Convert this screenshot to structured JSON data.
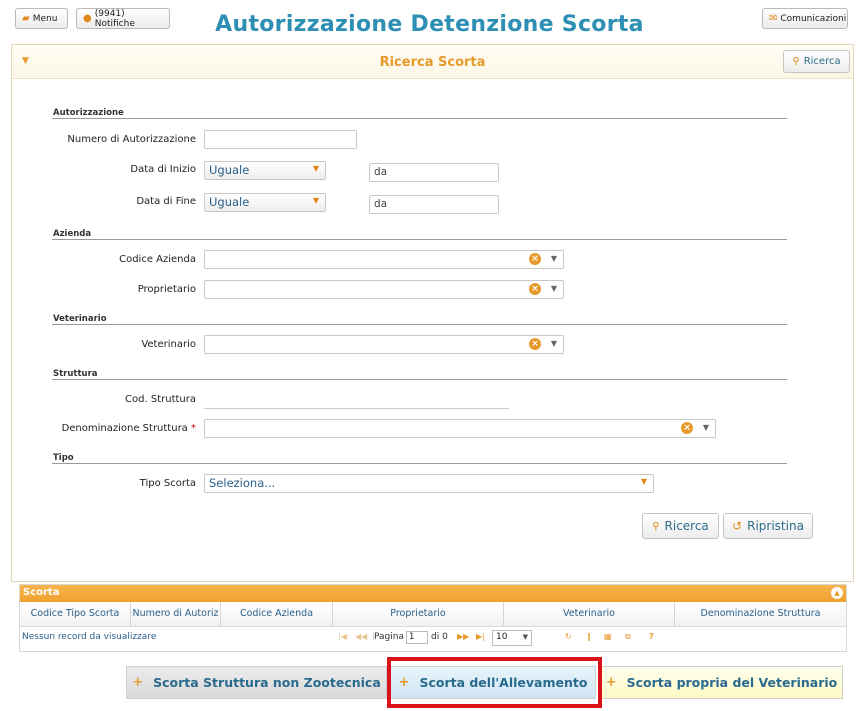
{
  "top": {
    "menu_label": "Menu",
    "notifications_label": "(9941) Notifiche",
    "communications_label": "Comunicazioni"
  },
  "page_title": "Autorizzazione Detenzione Scorta",
  "search": {
    "title": "Ricerca Scorta",
    "top_button": "Ricerca",
    "sections": {
      "autorizzazione": "Autorizzazione",
      "azienda": "Azienda",
      "veterinario": "Veterinario",
      "struttura": "Struttura",
      "tipo": "Tipo"
    },
    "fields": {
      "numero_autorizzazione": {
        "label": "Numero di Autorizzazione",
        "value": ""
      },
      "data_inizio": {
        "label": "Data di Inizio",
        "operator": "Uguale",
        "placeholder": "da"
      },
      "data_fine": {
        "label": "Data di Fine",
        "operator": "Uguale",
        "placeholder": "da"
      },
      "codice_azienda": {
        "label": "Codice Azienda",
        "value": ""
      },
      "proprietario": {
        "label": "Proprietario",
        "value": ""
      },
      "veterinario": {
        "label": "Veterinario",
        "value": ""
      },
      "cod_struttura": {
        "label": "Cod. Struttura",
        "value": ""
      },
      "denominazione_struttura": {
        "label": "Denominazione Struttura",
        "required_mark": "*",
        "value": ""
      },
      "tipo_scorta": {
        "label": "Tipo Scorta",
        "value": "Seleziona..."
      }
    },
    "actions": {
      "search_label": "Ricerca",
      "reset_label": "Ripristina"
    }
  },
  "grid": {
    "title": "Scorta",
    "columns": [
      "Codice Tipo Scorta",
      "Numero di Autoriz",
      "Codice Azienda",
      "Proprietario",
      "Veterinario",
      "Denominazione Struttura"
    ],
    "empty_message": "Nessun record da visualizzare",
    "pager": {
      "page_label": "Pagina",
      "page_value": "1",
      "of_label": "di 0",
      "page_size": "10",
      "help": "?"
    }
  },
  "tabs": [
    {
      "label": "Scorta Struttura non Zootecnica"
    },
    {
      "label": "Scorta dell'Allevamento"
    },
    {
      "label": "Scorta propria del Veterinario"
    }
  ],
  "colors": {
    "title_blue": "#2e8fb5",
    "accent_orange": "#e59a2b",
    "highlight_red": "#d9121b"
  }
}
